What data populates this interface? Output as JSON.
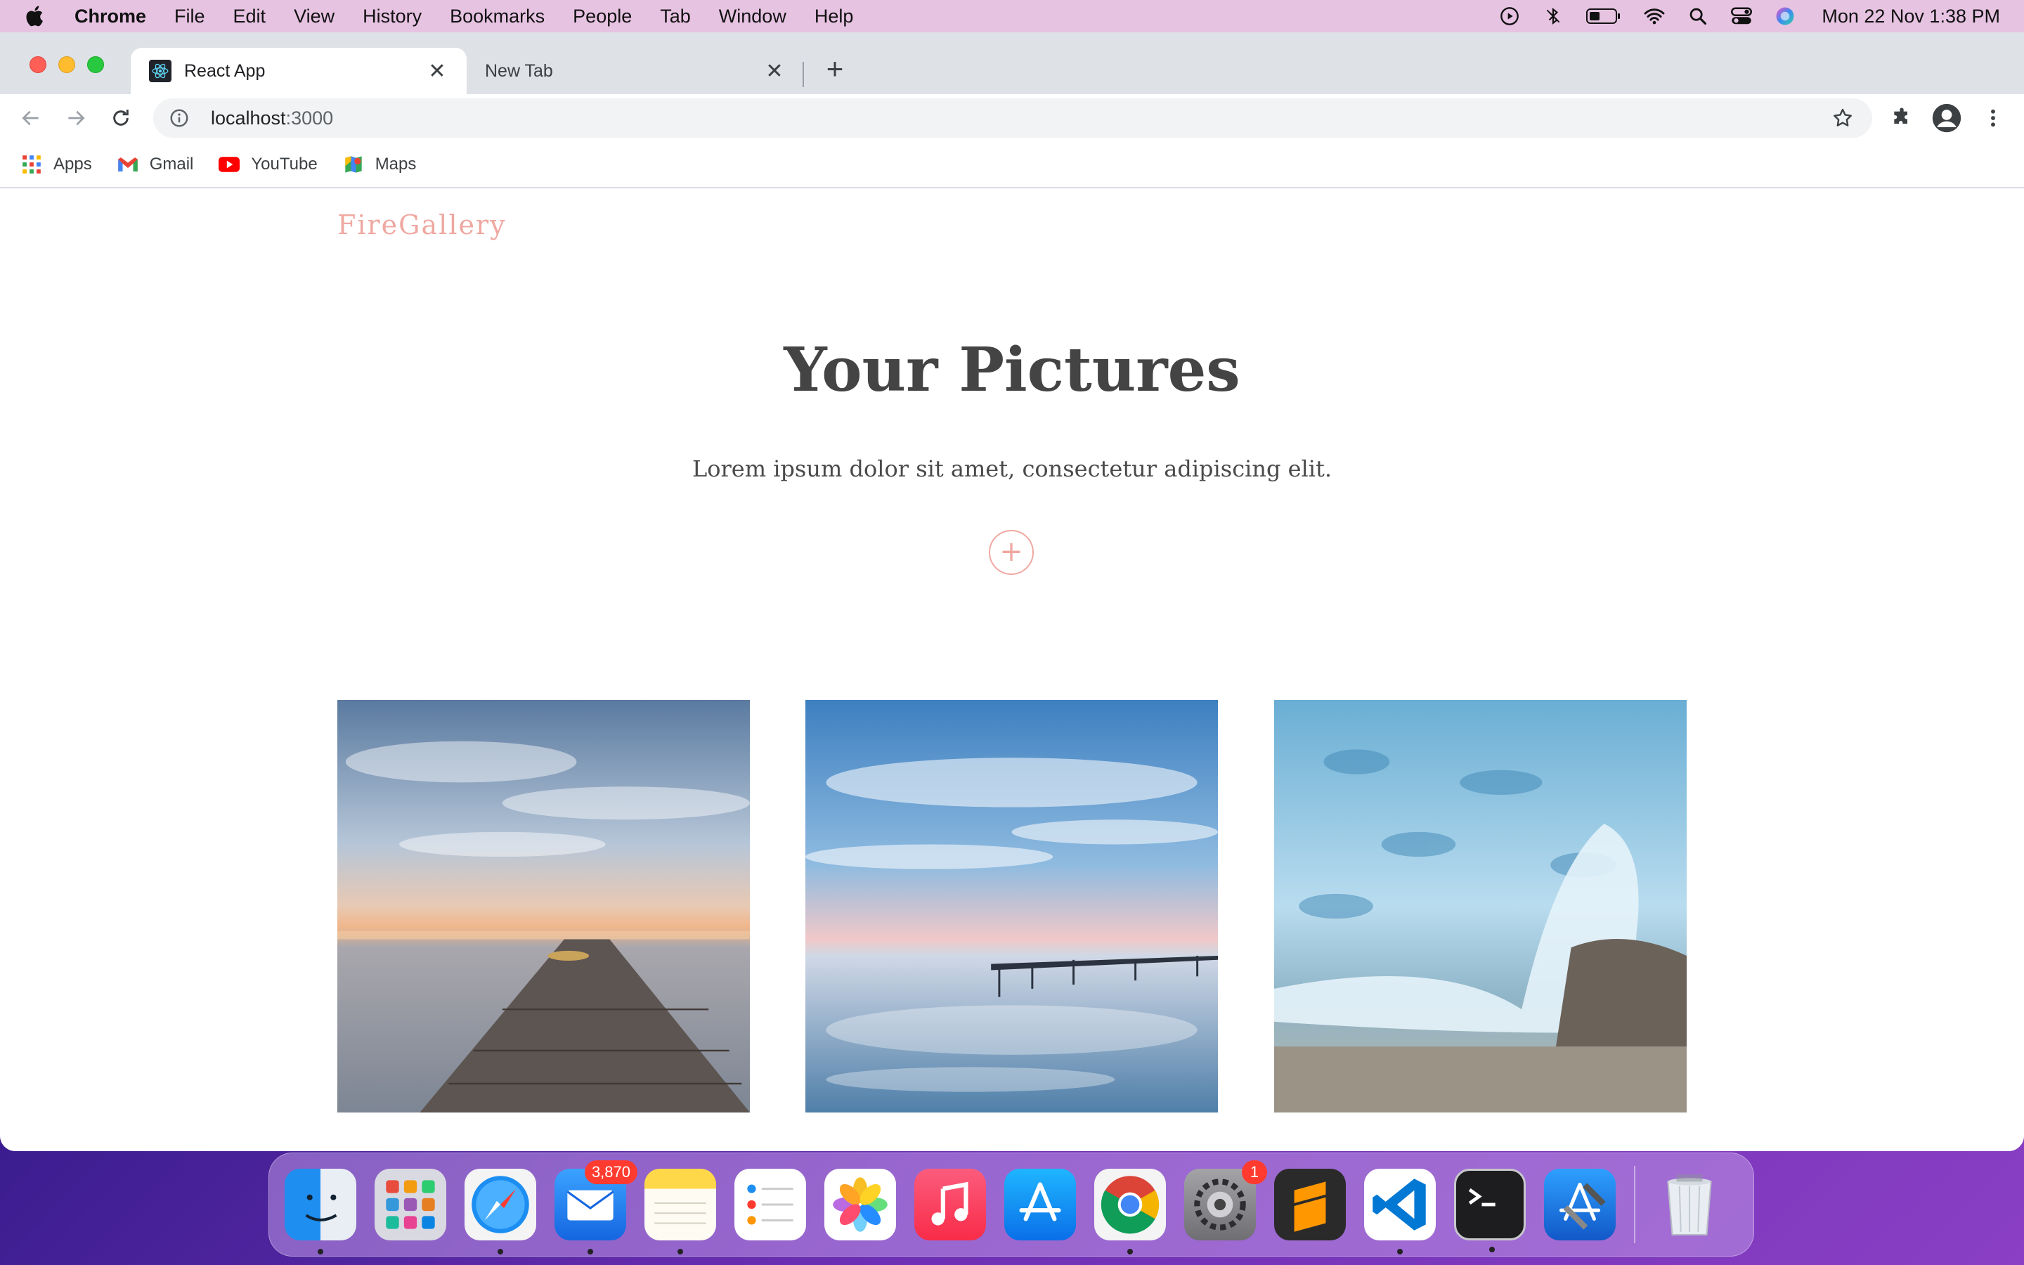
{
  "menubar": {
    "app": "Chrome",
    "items": [
      "File",
      "Edit",
      "View",
      "History",
      "Bookmarks",
      "People",
      "Tab",
      "Window",
      "Help"
    ],
    "clock": "Mon 22 Nov  1:38 PM"
  },
  "tabs": [
    {
      "label": "React App",
      "active": true
    },
    {
      "label": "New Tab",
      "active": false
    }
  ],
  "address": {
    "host": "localhost",
    "port": ":3000"
  },
  "bookmarks": [
    "Apps",
    "Gmail",
    "YouTube",
    "Maps"
  ],
  "page": {
    "brand": "FireGallery",
    "title": "Your Pictures",
    "subtitle": "Lorem ipsum dolor sit amet, consectetur adipiscing elit.",
    "add_label": "+"
  },
  "dock": {
    "mail_badge": "3,870",
    "settings_badge": "1"
  },
  "colors": {
    "brand": "#efa8a1",
    "menubar": "#e7c3e2",
    "tabstrip": "#dee1e6"
  }
}
